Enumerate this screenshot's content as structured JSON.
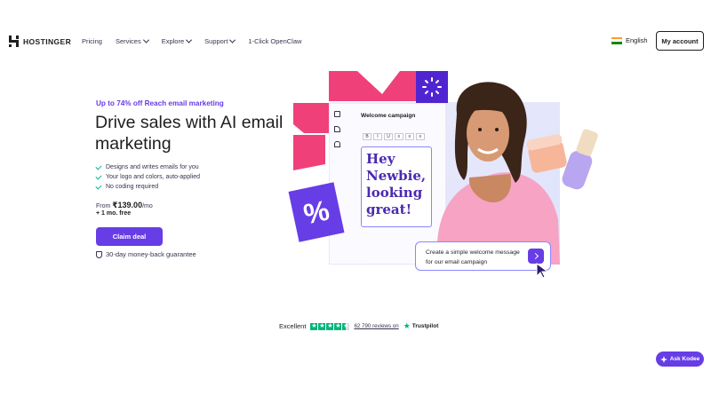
{
  "brand": {
    "name": "HOSTINGER",
    "accent": "#673de6",
    "pink": "#f0407a"
  },
  "nav": {
    "links": [
      {
        "label": "Pricing",
        "has_dropdown": false
      },
      {
        "label": "Services",
        "has_dropdown": true
      },
      {
        "label": "Explore",
        "has_dropdown": true
      },
      {
        "label": "Support",
        "has_dropdown": true
      },
      {
        "label": "1-Click OpenClaw",
        "has_dropdown": false
      }
    ],
    "language": "English",
    "account_button": "My account"
  },
  "hero": {
    "promo": "Up to 74% off Reach email marketing",
    "headline": "Drive sales with AI email marketing",
    "features": [
      "Designs and writes emails for you",
      "Your logo and colors, auto-applied",
      "No coding required"
    ],
    "price_prefix": "From ",
    "price": "₹139.00",
    "price_suffix": "/mo",
    "bonus": "+ 1 mo. free",
    "cta": "Claim deal",
    "guarantee": "30-day money-back guarantee"
  },
  "illustration": {
    "editor_title": "Welcome campaign",
    "format_buttons": [
      "B",
      "I",
      "U",
      "≡",
      "≡",
      "≡"
    ],
    "email_text": "Hey Newbie, looking great!",
    "discount_symbol": "%",
    "chat_prompt": "Create a simple welcome message for our email campaign"
  },
  "trustpilot": {
    "rating_label": "Excellent",
    "reviews_count": "62 790",
    "reviews_suffix": "reviews on",
    "brand": "Trustpilot"
  },
  "assistant": {
    "label": "Ask Kodee"
  }
}
